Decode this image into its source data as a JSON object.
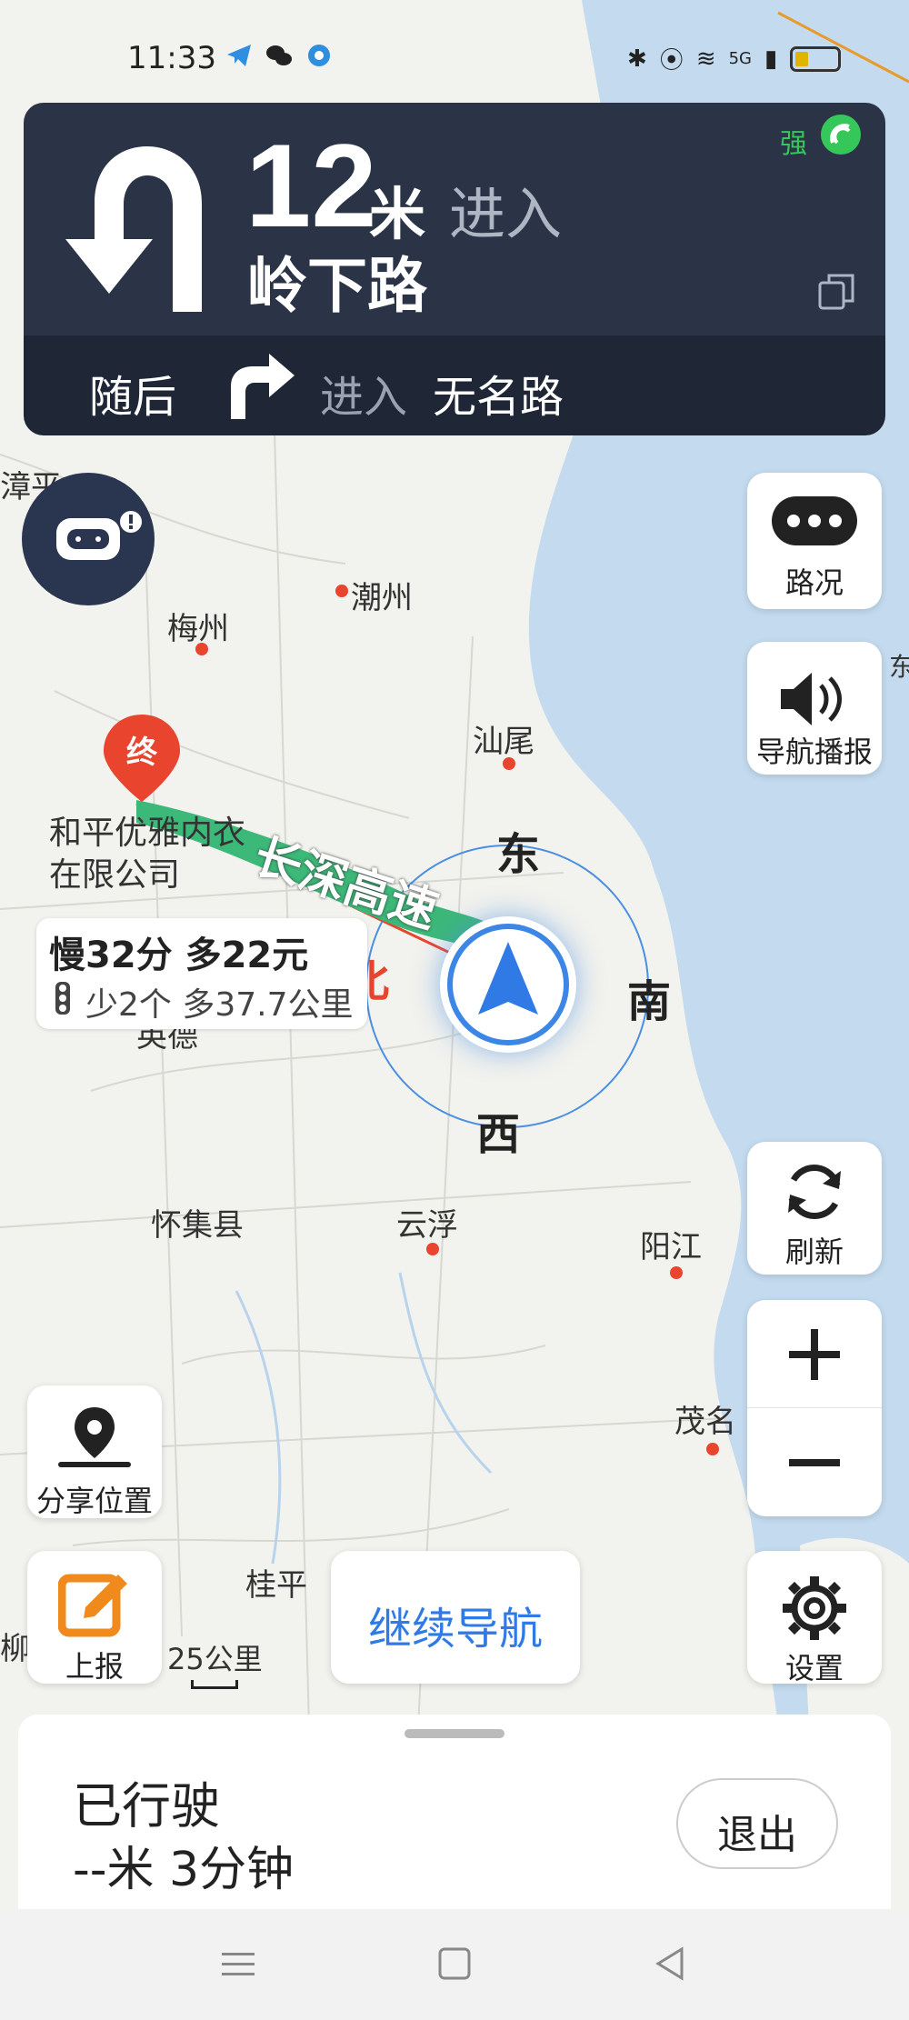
{
  "status_bar": {
    "time": "11:33",
    "network": "5G",
    "icons": [
      "telegram-icon",
      "wechat-icon",
      "app-dot-icon",
      "bluetooth-icon",
      "location-icon",
      "wifi-icon",
      "signal-icon",
      "battery-icon"
    ]
  },
  "navigation": {
    "distance": "12",
    "unit": "米",
    "action": "进入",
    "road": "岭下路",
    "signal_strength": "强",
    "next_label": "随后",
    "next_action": "进入",
    "next_road": "无名路"
  },
  "map": {
    "places": {
      "zhangping": "漳平",
      "chaozhou": "潮州",
      "meizhou": "梅州",
      "shanwei": "汕尾",
      "destination_name": "和平优雅内衣在限公司",
      "yingde": "英德",
      "huaiji": "怀集县",
      "yunfu": "云浮",
      "yangjiang": "阳江",
      "maoming": "茂名",
      "guiping": "桂平",
      "liu": "柳",
      "dong_edge": "东"
    },
    "road_name": "长深高速",
    "destination_marker": "终",
    "compass": {
      "east": "东",
      "south": "南",
      "west": "西",
      "north": "北"
    },
    "scale": "25公里"
  },
  "route_tip": {
    "main": "慢32分 多22元",
    "sub": "少2个 多37.7公里"
  },
  "buttons": {
    "traffic": "路况",
    "voice": "导航播报",
    "refresh": "刷新",
    "settings": "设置",
    "share_location": "分享位置",
    "report": "上报",
    "continue": "继续导航",
    "exit": "退出"
  },
  "trip": {
    "driven_label": "已行驶",
    "driven_value": "--米 3分钟"
  },
  "colors": {
    "nav_bg": "#2b3447",
    "accent_blue": "#2f7ae5",
    "route_green": "#3cb878",
    "marker_red": "#e8442e"
  }
}
